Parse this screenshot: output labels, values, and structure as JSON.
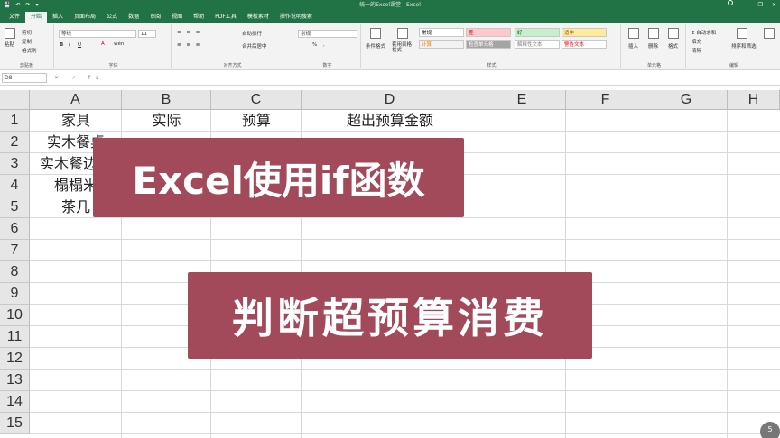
{
  "titlebar": {
    "title": "统一的Excel课堂  -  Excel",
    "quick_access": [
      "💾",
      "↶",
      "↷",
      "▾"
    ],
    "search_hint": "",
    "window_controls": [
      "—",
      "❐",
      "✕"
    ]
  },
  "tabs": [
    "文件",
    "开始",
    "插入",
    "页面布局",
    "公式",
    "数据",
    "审阅",
    "视图",
    "帮助",
    "PDF工具",
    "模板素材",
    "操作说明搜索"
  ],
  "active_tab": "开始",
  "ribbon": {
    "clipboard": {
      "label": "剪贴板",
      "paste": "粘贴",
      "cut": "剪切",
      "copy": "复制",
      "format_painter": "格式刷"
    },
    "font": {
      "label": "字体",
      "name": "等线",
      "size": "11",
      "bold": "B",
      "italic": "I",
      "underline": "U",
      "phonetic": "wén"
    },
    "alignment": {
      "label": "对齐方式",
      "wrap": "自动换行",
      "merge": "合并后居中"
    },
    "number": {
      "label": "数字",
      "format": "常规",
      "pct": "%",
      "comma": ","
    },
    "styles": {
      "label": "样式",
      "conditional": "条件格式",
      "table": "套用表格格式",
      "cells": [
        {
          "text": "常规",
          "bg": "#ffffff",
          "fg": "#000000"
        },
        {
          "text": "差",
          "bg": "#ffc7ce",
          "fg": "#9c0006"
        },
        {
          "text": "好",
          "bg": "#c6efce",
          "fg": "#006100"
        },
        {
          "text": "适中",
          "bg": "#ffeb9c",
          "fg": "#9c5700"
        },
        {
          "text": "计算",
          "bg": "#f2f2f2",
          "fg": "#fa7d00"
        },
        {
          "text": "检查单元格",
          "bg": "#a5a5a5",
          "fg": "#ffffff"
        },
        {
          "text": "解释性文本",
          "bg": "#ffffff",
          "fg": "#7f7f7f"
        },
        {
          "text": "警告文本",
          "bg": "#ffffff",
          "fg": "#ff0000"
        }
      ]
    },
    "cells_grp": {
      "label": "单元格",
      "insert": "插入",
      "delete": "删除",
      "format": "格式"
    },
    "editing": {
      "label": "编辑",
      "autosum": "自动求和",
      "fill": "填充",
      "clear": "清除",
      "sort": "排序和筛选",
      "find": "查找和选择"
    }
  },
  "formula_bar": {
    "name_box": "D8",
    "fx": "✕ ✓ fx",
    "formula": ""
  },
  "grid": {
    "columns": [
      "A",
      "B",
      "C",
      "D",
      "E",
      "F",
      "G",
      "H"
    ],
    "rows": [
      "1",
      "2",
      "3",
      "4",
      "5",
      "6",
      "7",
      "8",
      "9",
      "10",
      "11",
      "12",
      "13",
      "14",
      "15"
    ],
    "cells": {
      "A1": "家具",
      "B1": "实际",
      "C1": "预算",
      "D1": "超出预算金额",
      "A2": "实木餐桌",
      "A3": "实木餐边柜",
      "A4": "榻榻米",
      "A5": "茶几"
    }
  },
  "overlay": {
    "line1": "Excel使用if函数",
    "line2": "判断超预算消费",
    "color": "#a24a5a"
  },
  "corner_badge": "5"
}
